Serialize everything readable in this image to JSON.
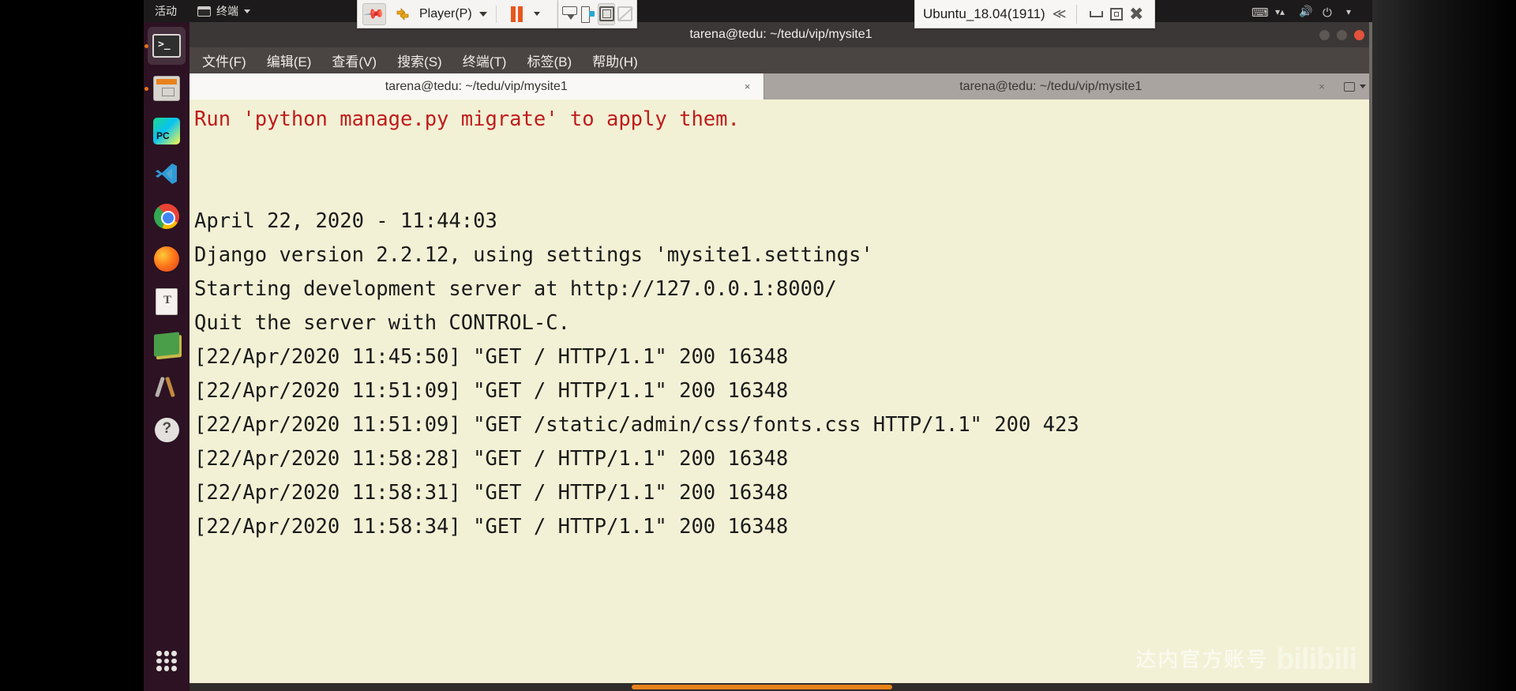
{
  "vmware": {
    "pin_icon": "pin-icon",
    "arrows_icon": "resize-arrows-icon",
    "player_menu_label": "Player(P)",
    "pause_icon": "pause-icon",
    "snapshot_icon": "snapshot-icon",
    "usb_icon": "usb-device-icon",
    "fullscreen_icon": "fullscreen-icon",
    "unity_icon": "unity-mode-icon",
    "vm_title": "Ubuntu_18.04(1911)",
    "collapse_icon": "double-chevron-left-icon",
    "minimize_icon": "minimize-icon",
    "restore_icon": "restore-icon",
    "close_icon": "close-icon"
  },
  "ubuntu_panel": {
    "activities": "活动",
    "app_name": "终端",
    "app_icon": "terminal-icon",
    "app_caret_icon": "chevron-down-icon",
    "tray": [
      {
        "name": "keyboard-layout-icon",
        "glyph": "⌨"
      },
      {
        "name": "network-icon",
        "glyph": "⇅"
      },
      {
        "name": "volume-icon",
        "glyph": "🔊"
      },
      {
        "name": "power-icon",
        "glyph": "⏻"
      },
      {
        "name": "system-menu-caret-icon",
        "glyph": "▾"
      }
    ]
  },
  "launcher": {
    "items": [
      {
        "name": "launcher-terminal",
        "icon": "terminal-icon",
        "running": true,
        "active": true
      },
      {
        "name": "launcher-files",
        "icon": "files-icon",
        "running": true,
        "active": false
      },
      {
        "name": "launcher-pycharm",
        "icon": "pycharm-icon",
        "running": false,
        "active": false
      },
      {
        "name": "launcher-vscode",
        "icon": "vscode-icon",
        "running": false,
        "active": false
      },
      {
        "name": "launcher-chrome",
        "icon": "chrome-icon",
        "running": false,
        "active": false
      },
      {
        "name": "launcher-firefox",
        "icon": "firefox-icon",
        "running": false,
        "active": false
      },
      {
        "name": "launcher-text-editor",
        "icon": "text-editor-icon",
        "running": false,
        "active": false
      },
      {
        "name": "launcher-help-books",
        "icon": "books-icon",
        "running": false,
        "active": false
      },
      {
        "name": "launcher-tools",
        "icon": "tools-icon",
        "running": false,
        "active": false
      },
      {
        "name": "launcher-help",
        "icon": "help-icon",
        "running": false,
        "active": false
      }
    ],
    "show_apps_icon": "apps-grid-icon"
  },
  "terminal": {
    "window_title": "tarena@tedu: ~/tedu/vip/mysite1",
    "menu": [
      "文件(F)",
      "编辑(E)",
      "查看(V)",
      "搜索(S)",
      "终端(T)",
      "标签(B)",
      "帮助(H)"
    ],
    "tabs": [
      {
        "label": "tarena@tedu: ~/tedu/vip/mysite1",
        "active": true,
        "close_icon": "close-tab-icon"
      },
      {
        "label": "tarena@tedu: ~/tedu/vip/mysite1",
        "active": false,
        "close_icon": "close-tab-icon"
      }
    ],
    "new_tab_icon": "new-tab-icon",
    "tab_list_caret_icon": "chevron-down-icon",
    "window_buttons": {
      "minimize": "minimize-icon",
      "maximize": "maximize-icon",
      "close": "close-icon"
    },
    "output": [
      {
        "text": "Run 'python manage.py migrate' to apply them.",
        "color": "red"
      },
      {
        "text": "",
        "color": "normal"
      },
      {
        "text": "April 22, 2020 - 11:44:03",
        "color": "normal"
      },
      {
        "text": "Django version 2.2.12, using settings 'mysite1.settings'",
        "color": "normal"
      },
      {
        "text": "Starting development server at http://127.0.0.1:8000/",
        "color": "normal"
      },
      {
        "text": "Quit the server with CONTROL-C.",
        "color": "normal"
      },
      {
        "text": "[22/Apr/2020 11:45:50] \"GET / HTTP/1.1\" 200 16348",
        "color": "normal"
      },
      {
        "text": "[22/Apr/2020 11:51:09] \"GET / HTTP/1.1\" 200 16348",
        "color": "normal"
      },
      {
        "text": "[22/Apr/2020 11:51:09] \"GET /static/admin/css/fonts.css HTTP/1.1\" 200 423",
        "color": "normal"
      },
      {
        "text": "[22/Apr/2020 11:58:28] \"GET / HTTP/1.1\" 200 16348",
        "color": "normal"
      },
      {
        "text": "[22/Apr/2020 11:58:31] \"GET / HTTP/1.1\" 200 16348",
        "color": "normal"
      },
      {
        "text": "[22/Apr/2020 11:58:34] \"GET / HTTP/1.1\" 200 16348",
        "color": "normal"
      }
    ],
    "colors": {
      "background": "#f2f1d5",
      "foreground": "#1a1a1a",
      "error_text": "#c01c1c",
      "accent_orange": "#e8821a"
    }
  },
  "watermark": {
    "text": "达内官方账号",
    "logo": "bilibili"
  }
}
